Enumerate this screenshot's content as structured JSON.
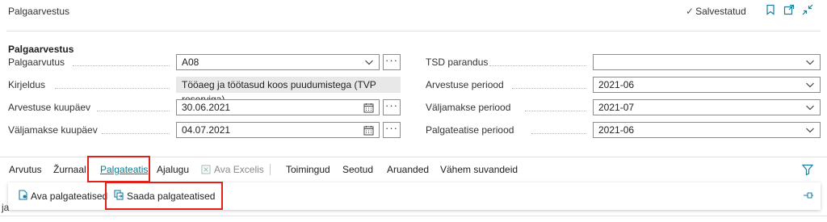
{
  "header": {
    "page_name": "Palgaarvestus",
    "saved_status": "Salvestatud",
    "icons": [
      "checkmark-icon",
      "bookmark-icon",
      "open-in-new-window-icon",
      "collapse-icon"
    ]
  },
  "group": {
    "title": "Palgaarvestus"
  },
  "fields_left": [
    {
      "label": "Palgaarvutus",
      "value": "A08",
      "kind": "dropdown-lookup"
    },
    {
      "label": "Kirjeldus",
      "value": "Tööaeg ja töötasud koos puudumistega (TVP reserviga)",
      "kind": "readonly"
    },
    {
      "label": "Arvestuse kuupäev",
      "value": "30.06.2021",
      "kind": "date"
    },
    {
      "label": "Väljamakse kuupäev",
      "value": "04.07.2021",
      "kind": "date"
    }
  ],
  "fields_right": [
    {
      "label": "TSD parandus",
      "value": "",
      "kind": "dropdown"
    },
    {
      "label": "Arvestuse periood",
      "value": "2021-06",
      "kind": "dropdown"
    },
    {
      "label": "Väljamakse periood",
      "value": "2021-07",
      "kind": "dropdown"
    },
    {
      "label": "Palgateatise periood",
      "value": "2021-06",
      "kind": "dropdown"
    }
  ],
  "more_label": "···",
  "actions": [
    {
      "label": "Arvutus"
    },
    {
      "label": "Žurnaal"
    },
    {
      "label": "Palgateatis",
      "state": "active"
    },
    {
      "label": "Ajalugu"
    },
    {
      "label": "Ava Excelis",
      "state": "disabled"
    },
    {
      "label": "Toimingud"
    },
    {
      "label": "Seotud"
    },
    {
      "label": "Aruanded"
    },
    {
      "label": "Vähem suvandeid"
    }
  ],
  "sub_actions": [
    {
      "label": "Ava palgateatised"
    },
    {
      "label": "Saada palgateatised"
    }
  ],
  "fragment_text": "ja",
  "colors": {
    "accent": "#0f7a8a",
    "highlight_box": "#e0201b",
    "readonly_bg": "#e8e8e8"
  }
}
